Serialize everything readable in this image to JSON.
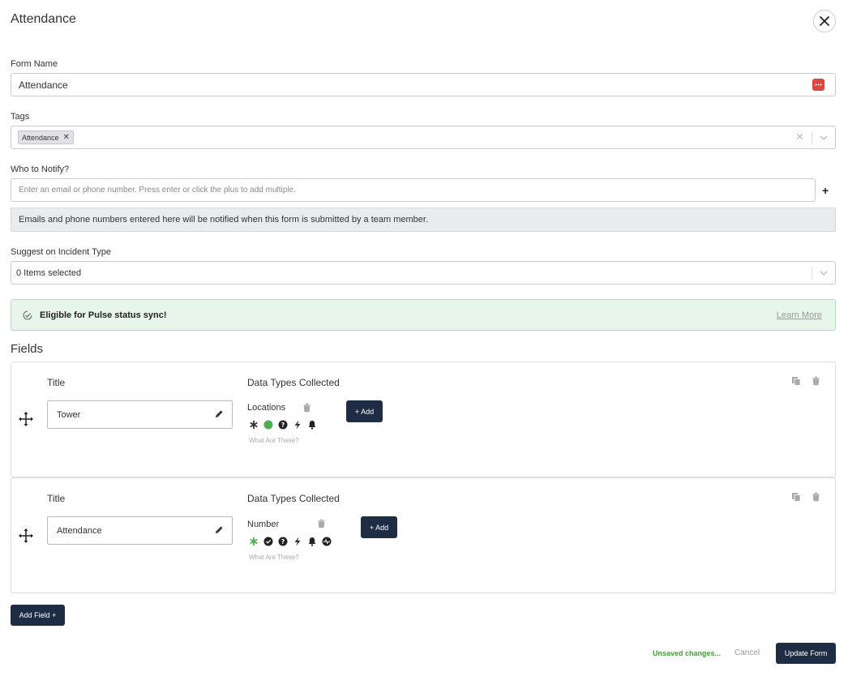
{
  "modal": {
    "title": "Attendance"
  },
  "form_name": {
    "label": "Form Name",
    "value": "Attendance"
  },
  "tags": {
    "label": "Tags",
    "items": [
      "Attendance"
    ]
  },
  "notify": {
    "label": "Who to Notify?",
    "placeholder": "Enter an email or phone number. Press enter or click the plus to add multiple.",
    "info": "Emails and phone numbers entered here will be notified when this form is submitted by a team member."
  },
  "incident": {
    "label": "Suggest on Incident Type",
    "value": "0 Items selected"
  },
  "pulse": {
    "text": "Eligible for Pulse status sync!",
    "link": "Learn More"
  },
  "fields": {
    "heading": "Fields",
    "items": [
      {
        "title_label": "Title",
        "dtc_label": "Data Types Collected",
        "title_value": "Tower",
        "data_type": "Locations",
        "add_label": "+ Add",
        "what_label": "What Are These?",
        "icons": [
          "asterisk-icon",
          "green-dot-icon",
          "question-icon",
          "bolt-icon",
          "bell-icon"
        ]
      },
      {
        "title_label": "Title",
        "dtc_label": "Data Types Collected",
        "title_value": "Attendance",
        "data_type": "Number",
        "add_label": "+ Add",
        "what_label": "What Are These?",
        "icons": [
          "green-asterisk-icon",
          "check-circle-icon",
          "question-icon",
          "bolt-icon",
          "bell-icon",
          "pulse-icon"
        ]
      }
    ]
  },
  "footer": {
    "add_field": "Add Field +",
    "unsaved": "Unsaved changes...",
    "cancel": "Cancel",
    "update": "Update Form"
  },
  "colors": {
    "primary": "#1f2d44",
    "danger": "#d9493e",
    "success": "#4a9a41",
    "pulse_bg": "#e8f5ea"
  }
}
